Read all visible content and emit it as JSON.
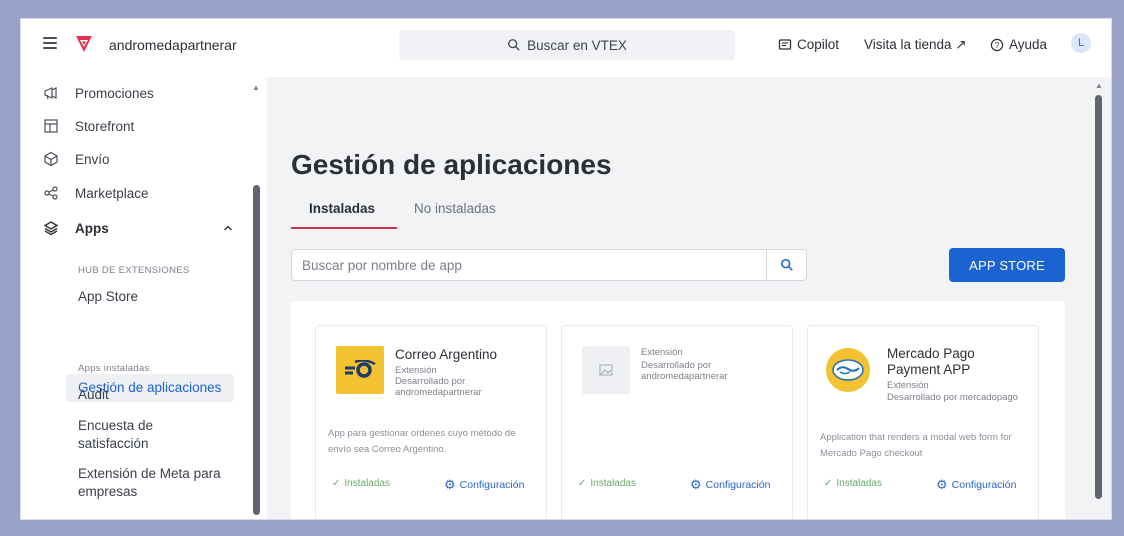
{
  "header": {
    "account": "andromedapartnerar",
    "search_label": "Buscar en VTEX",
    "copilot": "Copilot",
    "visit_store": "Visita la tienda ↗",
    "help": "Ayuda",
    "avatar_initial": "L",
    "brand_color": "#e0344c"
  },
  "sidebar": {
    "items": [
      {
        "label": "Promociones",
        "icon": "megaphone-icon"
      },
      {
        "label": "Storefront",
        "icon": "layout-icon"
      },
      {
        "label": "Envío",
        "icon": "box-icon"
      },
      {
        "label": "Marketplace",
        "icon": "share-nodes-icon"
      },
      {
        "label": "Apps",
        "icon": "layers-icon"
      }
    ],
    "section_hub": "HUB DE EXTENSIONES",
    "app_store": "App Store",
    "gestion": "Gestión de aplicaciones",
    "section_installed": "Apps instaladas",
    "installed": [
      "Audit",
      "Encuesta de satisfacción",
      "Extensión de Meta para empresas"
    ]
  },
  "main": {
    "title": "Gestión de aplicaciones",
    "tabs": [
      "Instaladas",
      "No instaladas"
    ],
    "search_placeholder": "Buscar por nombre de app",
    "app_store_button": "APP STORE",
    "cards": [
      {
        "name": "Correo Argentino",
        "type": "Extensión",
        "developer": "Desarrollado por andromedapartnerar",
        "description": "App para gestionar ordenes cuyo método de envío sea Correo Argentino.",
        "status": "Instaladas",
        "config": "Configuración",
        "icon_color": "#f2c230"
      },
      {
        "name": "",
        "type": "Extensión",
        "developer": "Desarrollado por andromedapartnerar",
        "description": "",
        "status": "Instaladas",
        "config": "Configuración",
        "icon_color": "#eef0f3"
      },
      {
        "name": "Mercado Pago Payment APP",
        "type": "Extensión",
        "developer": "Desarrollado por mercadopago",
        "description": "Application that renders a modal web form for Mercado Pago checkout",
        "status": "Instaladas",
        "config": "Configuración",
        "icon_color": "#f2c230"
      }
    ]
  },
  "colors": {
    "accent_blue": "#1b63d1",
    "tab_underline": "#c9314d",
    "installed_green": "#6aaa6a"
  }
}
